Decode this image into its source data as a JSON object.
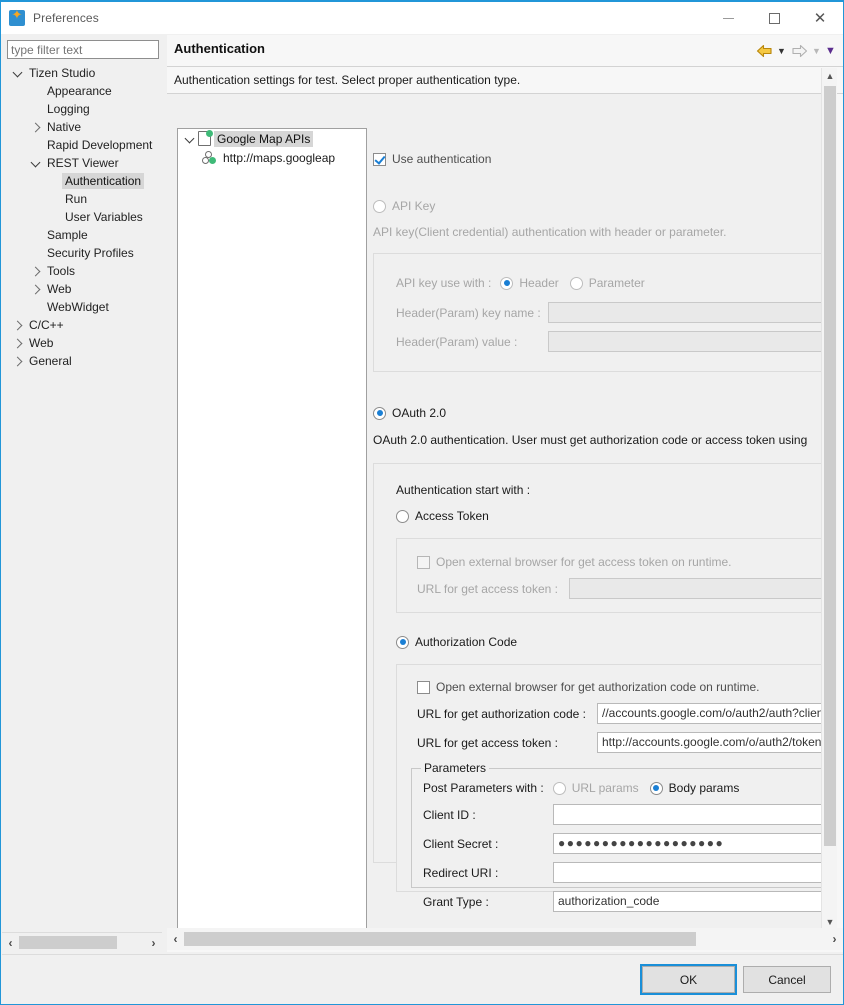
{
  "window": {
    "title": "Preferences",
    "app_icon": "tizen-star-icon",
    "controls": {
      "minimize": "minimize",
      "maximize": "maximize",
      "close": "close"
    }
  },
  "filter": {
    "placeholder": "type filter text",
    "value": ""
  },
  "sidebar": {
    "items": [
      {
        "label": "Tizen Studio",
        "indent": 0,
        "twisty": "expanded",
        "selected": false
      },
      {
        "label": "Appearance",
        "indent": 1,
        "twisty": "none",
        "selected": false
      },
      {
        "label": "Logging",
        "indent": 1,
        "twisty": "none",
        "selected": false
      },
      {
        "label": "Native",
        "indent": 1,
        "twisty": "collapsed",
        "selected": false
      },
      {
        "label": "Rapid Development",
        "indent": 1,
        "twisty": "none",
        "selected": false
      },
      {
        "label": "REST Viewer",
        "indent": 1,
        "twisty": "expanded",
        "selected": false
      },
      {
        "label": "Authentication",
        "indent": 2,
        "twisty": "none",
        "selected": true
      },
      {
        "label": "Run",
        "indent": 2,
        "twisty": "none",
        "selected": false
      },
      {
        "label": "User Variables",
        "indent": 2,
        "twisty": "none",
        "selected": false
      },
      {
        "label": "Sample",
        "indent": 1,
        "twisty": "none",
        "selected": false
      },
      {
        "label": "Security Profiles",
        "indent": 1,
        "twisty": "none",
        "selected": false
      },
      {
        "label": "Tools",
        "indent": 1,
        "twisty": "collapsed",
        "selected": false
      },
      {
        "label": "Web",
        "indent": 1,
        "twisty": "collapsed",
        "selected": false
      },
      {
        "label": "WebWidget",
        "indent": 1,
        "twisty": "none",
        "selected": false
      },
      {
        "label": "C/C++",
        "indent": 0,
        "twisty": "collapsed",
        "selected": false
      },
      {
        "label": "Web",
        "indent": 0,
        "twisty": "collapsed",
        "selected": false
      },
      {
        "label": "General",
        "indent": 0,
        "twisty": "collapsed",
        "selected": false
      }
    ]
  },
  "pane": {
    "title": "Authentication",
    "description": "Authentication settings for test. Select proper authentication type.",
    "nav": {
      "back_icon": "back-arrow-icon",
      "back_menu_icon": "chevron-down-icon",
      "forward_icon": "forward-arrow-icon",
      "forward_menu_icon": "chevron-down-icon",
      "more_icon": "chevron-down-icon"
    }
  },
  "api_tree": {
    "root": {
      "label": "Google Map APIs",
      "icon": "document-icon",
      "twisty": "expanded",
      "selected": true
    },
    "child": {
      "label": "http://maps.googleap",
      "icon": "link-nodes-icon"
    }
  },
  "form": {
    "use_authentication": {
      "label": "Use authentication",
      "checked": true
    },
    "api_key": {
      "radio_label": "API Key",
      "selected": false,
      "description": "API key(Client credential) authentication with header or parameter.",
      "use_with_label": "API key use with :",
      "option_header": "Header",
      "option_parameter": "Parameter",
      "use_with_selected": "Header",
      "key_name_label": "Header(Param) key name :",
      "key_name_value": "",
      "value_label": "Header(Param) value :",
      "value_value": ""
    },
    "oauth": {
      "radio_label": "OAuth 2.0",
      "selected": true,
      "description": "OAuth 2.0 authentication. User must get authorization code or access token using",
      "start_with_label": "Authentication start with :",
      "access_token": {
        "radio_label": "Access Token",
        "selected": false,
        "open_browser_label": "Open external browser for get access token on runtime.",
        "open_browser_checked": false,
        "url_label": "URL for get access token :",
        "url_value": ""
      },
      "authorization_code": {
        "radio_label": "Authorization Code",
        "selected": true,
        "open_browser_label": "Open external browser for get authorization code on runtime.",
        "open_browser_checked": false,
        "auth_url_label": "URL for get authorization code :",
        "auth_url_value": "//accounts.google.com/o/auth2/auth?clien",
        "token_url_label": "URL for get access token :",
        "token_url_value": "http://accounts.google.com/o/auth2/token",
        "parameters": {
          "group_title": "Parameters",
          "post_with_label": "Post Parameters with :",
          "option_url": "URL params",
          "option_body": "Body params",
          "post_with_selected": "Body params",
          "fields": [
            {
              "label": "Client ID :",
              "value": "",
              "masked": false
            },
            {
              "label": "Client Secret :",
              "value": "●●●●●●●●●●●●●●●●●●●",
              "masked": true
            },
            {
              "label": "Redirect URI :",
              "value": "",
              "masked": false
            },
            {
              "label": "Grant Type :",
              "value": "authorization_code",
              "masked": false
            }
          ]
        }
      }
    }
  },
  "footer": {
    "ok": "OK",
    "cancel": "Cancel"
  },
  "colors": {
    "accent": "#1a7fd4",
    "window_border": "#2196d8",
    "selection": "#d6d6d6",
    "green_badge": "#3fba78"
  }
}
